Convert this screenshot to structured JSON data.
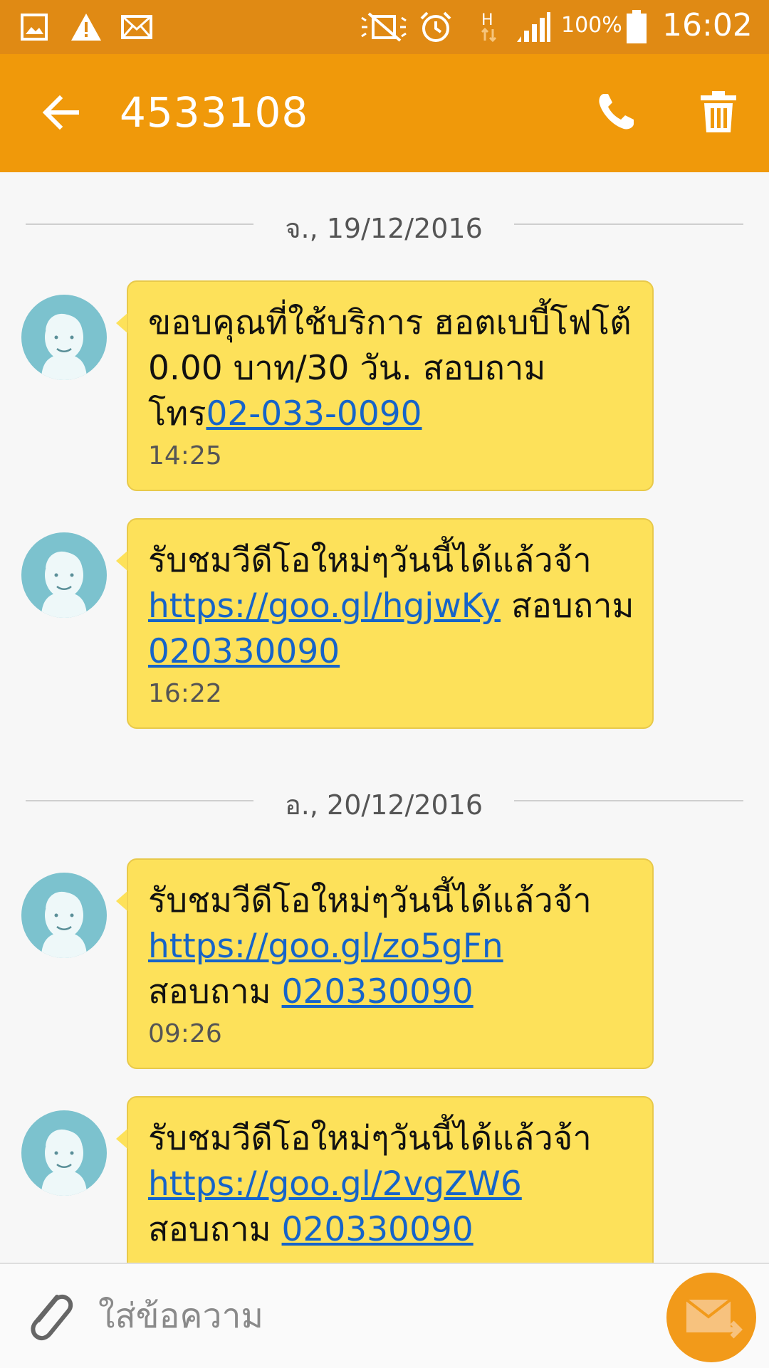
{
  "status_bar": {
    "icons": [
      "gallery-icon",
      "warning-icon",
      "mail-icon",
      "mute-icon",
      "alarm-icon",
      "hplus-data-icon",
      "signal-icon",
      "battery-icon"
    ],
    "battery": "100%",
    "time": "16:02",
    "data_label": "H"
  },
  "header": {
    "title": "4533108",
    "colors": {
      "status": "#e08a14",
      "bar": "#f0990a"
    }
  },
  "dates": [
    "จ., 19/12/2016",
    "อ., 20/12/2016"
  ],
  "messages": [
    {
      "text": "ขอบคุณที่ใช้บริการ ฮอตเบบี้โฟโต้  0.00 บาท/30 วัน. สอบถามโทร",
      "link": "02-033-0090",
      "link2": "",
      "time": "14:25"
    },
    {
      "text": "รับชมวีดีโอใหม่ๆวันนี้ได้แล้วจ้า ",
      "link": "https://goo.gl/hgjwKy",
      "mid": " สอบถาม ",
      "link2": "020330090",
      "time": "16:22"
    },
    {
      "text": "รับชมวีดีโอใหม่ๆวันนี้ได้แล้วจ้า ",
      "link": "https://goo.gl/zo5gFn",
      "mid": " สอบถาม ",
      "link2": "020330090",
      "time": "09:26"
    },
    {
      "text": "รับชมวีดีโอใหม่ๆวันนี้ได้แล้วจ้า ",
      "link": "https://goo.gl/2vgZW6",
      "mid": " สอบถาม ",
      "link2": "020330090",
      "time": ""
    }
  ],
  "compose": {
    "placeholder": "ใส่ข้อความ"
  }
}
